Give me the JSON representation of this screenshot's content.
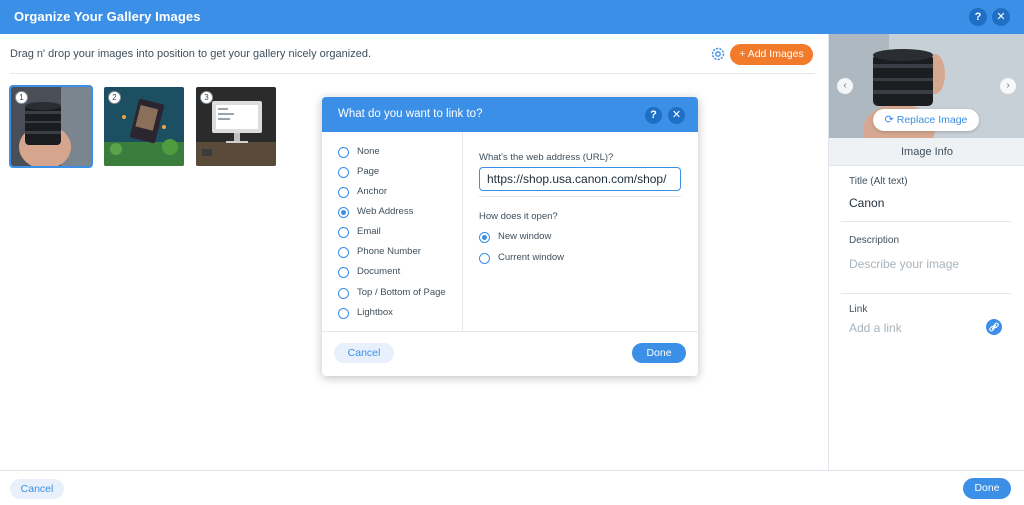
{
  "header": {
    "title": "Organize Your Gallery Images",
    "help_label": "?",
    "close_label": "✕"
  },
  "main": {
    "instructions": "Drag n' drop your images into position to get your gallery nicely organized.",
    "add_images_label": "+  Add Images",
    "thumbnails": [
      {
        "number": "1"
      },
      {
        "number": "2"
      },
      {
        "number": "3"
      }
    ]
  },
  "modal": {
    "title": "What do you want to link to?",
    "help_label": "?",
    "close_label": "✕",
    "link_types": [
      "None",
      "Page",
      "Anchor",
      "Web Address",
      "Email",
      "Phone Number",
      "Document",
      "Top / Bottom of Page",
      "Lightbox"
    ],
    "selected_link_type": "Web Address",
    "url_label": "What's the web address (URL)?",
    "url_value": "https://shop.usa.canon.com/shop/",
    "open_label": "How does it open?",
    "open_options": [
      "New window",
      "Current window"
    ],
    "selected_open_option": "New window",
    "cancel_label": "Cancel",
    "done_label": "Done"
  },
  "info_panel": {
    "replace_label": "Replace Image",
    "header": "Image Info",
    "title_label": "Title (Alt text)",
    "title_value": "Canon",
    "description_label": "Description",
    "description_placeholder": "Describe your image",
    "link_label": "Link",
    "link_placeholder": "Add a link"
  },
  "footer": {
    "cancel_label": "Cancel",
    "done_label": "Done"
  },
  "colors": {
    "accent": "#3b8fe6",
    "add_button": "#f17a2b",
    "header": "#3b8fe6"
  }
}
